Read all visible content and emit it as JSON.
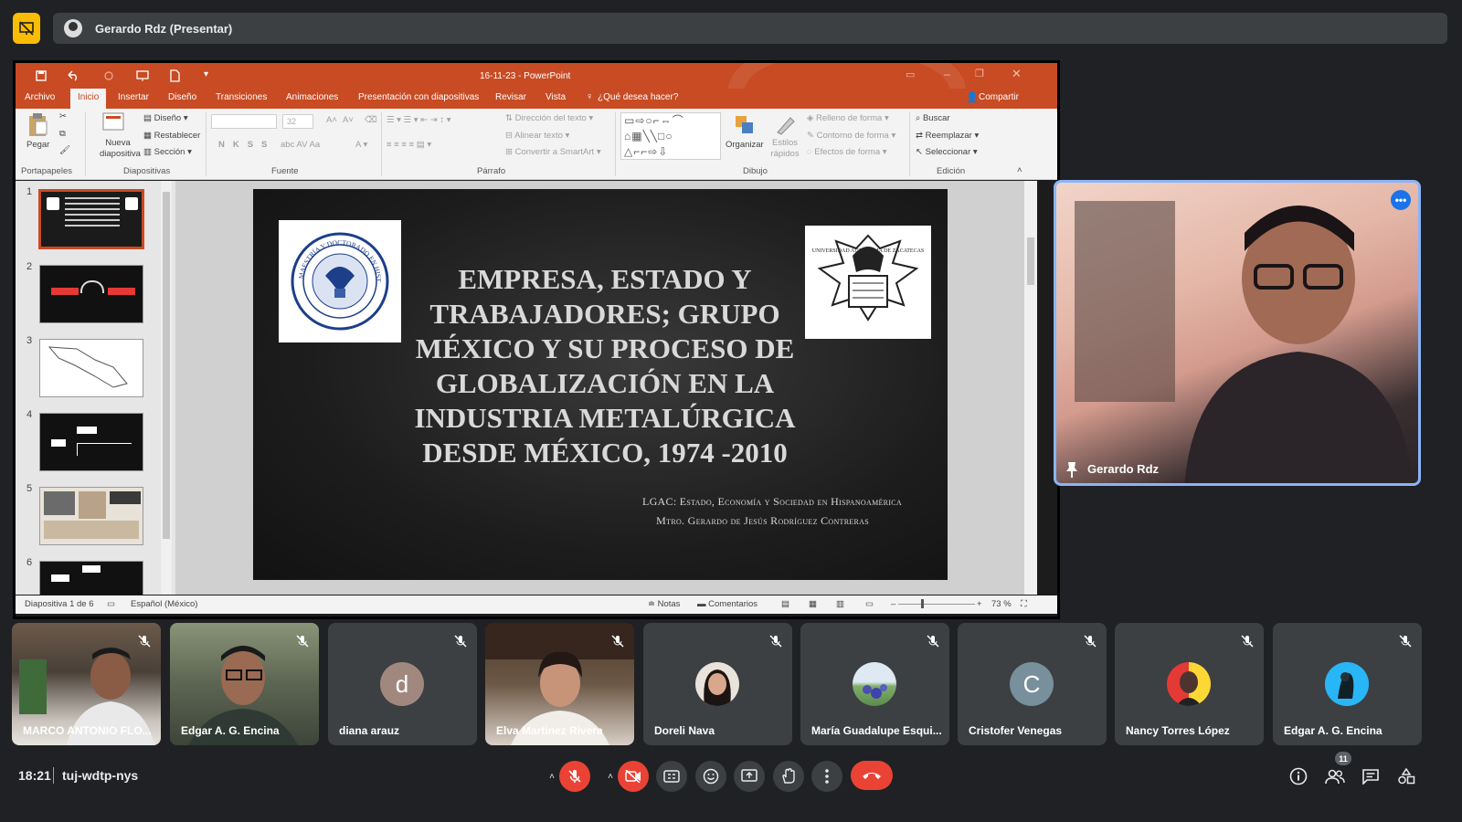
{
  "meeting": {
    "presenter_label": "Gerardo Rdz (Presentar)",
    "time": "18:21",
    "code": "tuj-wdtp-nys",
    "participant_count": "11"
  },
  "powerpoint": {
    "window_title": "16-11-23 - PowerPoint",
    "tabs": [
      "Archivo",
      "Inicio",
      "Insertar",
      "Diseño",
      "Transiciones",
      "Animaciones",
      "Presentación con diapositivas",
      "Revisar",
      "Vista"
    ],
    "tell_me": "¿Qué desea hacer?",
    "share": "Compartir",
    "ribbon": {
      "paste": "Pegar",
      "new_slide": "Nueva diapositiva",
      "layout": "Diseño",
      "reset": "Restablecer",
      "section": "Sección",
      "font_size": "32",
      "text_direction": "Dirección del texto",
      "align_text": "Alinear texto",
      "convert_smartart": "Convertir a SmartArt",
      "arrange": "Organizar",
      "quick_styles": "Estilos rápidos",
      "shape_fill": "Relleno de forma",
      "shape_outline": "Contorno de forma",
      "shape_effects": "Efectos de forma",
      "find": "Buscar",
      "replace": "Reemplazar",
      "select": "Seleccionar",
      "groups": {
        "clipboard": "Portapapeles",
        "slides": "Diapositivas",
        "font": "Fuente",
        "paragraph": "Párrafo",
        "drawing": "Dibujo",
        "editing": "Edición"
      }
    },
    "thumb_numbers": [
      "1",
      "2",
      "3",
      "4",
      "5",
      "6"
    ],
    "slide": {
      "title": "EMPRESA, ESTADO Y TRABAJADORES; GRUPO MÉXICO Y SU PROCESO DE GLOBALIZACIÓN EN LA INDUSTRIA METALÚRGICA DESDE MÉXICO, 1974 -2010",
      "lgac": "LGAC: Estado, Economía y Sociedad en Hispanoamérica",
      "author": "Mtro. Gerardo de Jesús Rodríguez Contreras",
      "left_logo_text": "MAESTRÍA Y DOCTORADO EN HISTORIA",
      "right_logo_text": "UNIVERSIDAD AUTÓNOMA DE ZACATECAS"
    },
    "status": {
      "slide_info": "Diapositiva 1 de 6",
      "language": "Español (México)",
      "notes": "Notas",
      "comments": "Comentarios",
      "zoom": "73 %"
    }
  },
  "pinned": {
    "name": "Gerardo Rdz"
  },
  "participants": [
    {
      "name": "MARCO ANTONIO FLO...",
      "type": "video"
    },
    {
      "name": "Edgar A. G. Encina",
      "type": "video"
    },
    {
      "name": "diana arauz",
      "type": "letter",
      "letter": "d",
      "color": "#a1887f"
    },
    {
      "name": "Elva Martinez Rivera",
      "type": "video"
    },
    {
      "name": "Doreli Nava",
      "type": "photo"
    },
    {
      "name": "María Guadalupe Esqui...",
      "type": "photo"
    },
    {
      "name": "Cristofer Venegas",
      "type": "letter",
      "letter": "C",
      "color": "#78909c"
    },
    {
      "name": "Nancy Torres López",
      "type": "photo"
    },
    {
      "name": "Edgar A. G. Encina",
      "type": "photo"
    }
  ],
  "colors": {
    "accent_red": "#ea4335",
    "ppt_orange": "#c84b24",
    "pinned_border": "#8ab4f8",
    "present_yellow": "#fbbc04"
  }
}
